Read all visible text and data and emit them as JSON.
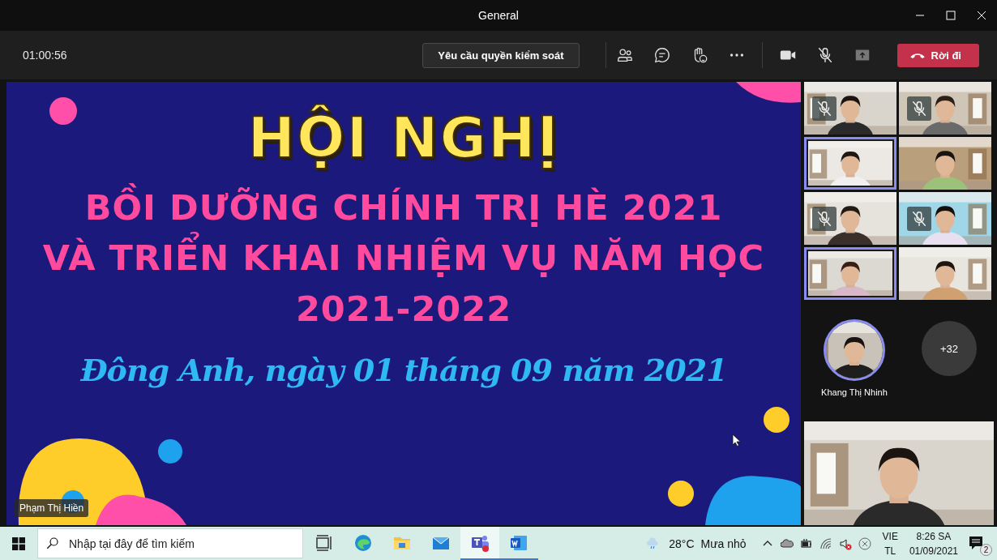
{
  "window": {
    "title": "General"
  },
  "call_bar": {
    "timer": "01:00:56",
    "request_control": "Yêu cầu quyền kiểm soát",
    "camera_on": true,
    "mic_muted": true,
    "leave": "Rời đi"
  },
  "slide": {
    "title": "HỘI NGHỊ",
    "lines": [
      "BỒI DƯỠNG CHÍNH TRỊ HÈ 2021",
      "VÀ TRIỂN KHAI NHIỆM VỤ NĂM HỌC",
      "2021-2022"
    ],
    "place_date": "Đông Anh, ngày 01 tháng 09 năm 2021",
    "presenter": "Phạm Thị Hiền"
  },
  "participants": [
    {
      "kind": "picture",
      "muted": true,
      "speaking": false
    },
    {
      "kind": "picture",
      "muted": true,
      "speaking": false
    },
    {
      "kind": "picture",
      "muted": false,
      "speaking": true
    },
    {
      "kind": "picture",
      "muted": false,
      "speaking": false
    },
    {
      "kind": "picture",
      "muted": true,
      "speaking": false
    },
    {
      "kind": "picture",
      "muted": true,
      "speaking": false
    },
    {
      "kind": "picture",
      "muted": false,
      "speaking": true
    },
    {
      "kind": "picture",
      "muted": false,
      "speaking": false
    }
  ],
  "featured": {
    "name": "Khang Thị Nhinh",
    "overflow": "+32"
  },
  "taskbar": {
    "search_placeholder": "Nhập tại đây để tìm kiếm",
    "apps": [
      {
        "kind": "task-view",
        "selected": false,
        "running": false
      },
      {
        "kind": "browser",
        "selected": false,
        "running": false
      },
      {
        "kind": "folder",
        "selected": false,
        "running": false
      },
      {
        "kind": "mail",
        "selected": false,
        "running": false
      },
      {
        "kind": "teams",
        "selected": true,
        "running": true
      },
      {
        "kind": "word",
        "selected": false,
        "running": true
      }
    ],
    "temperature": "28°C",
    "weather": "Mưa nhỏ",
    "language": "VIE",
    "layout": "TL",
    "time": "8:26 SA",
    "date": "01/09/2021",
    "notifications": "2"
  }
}
